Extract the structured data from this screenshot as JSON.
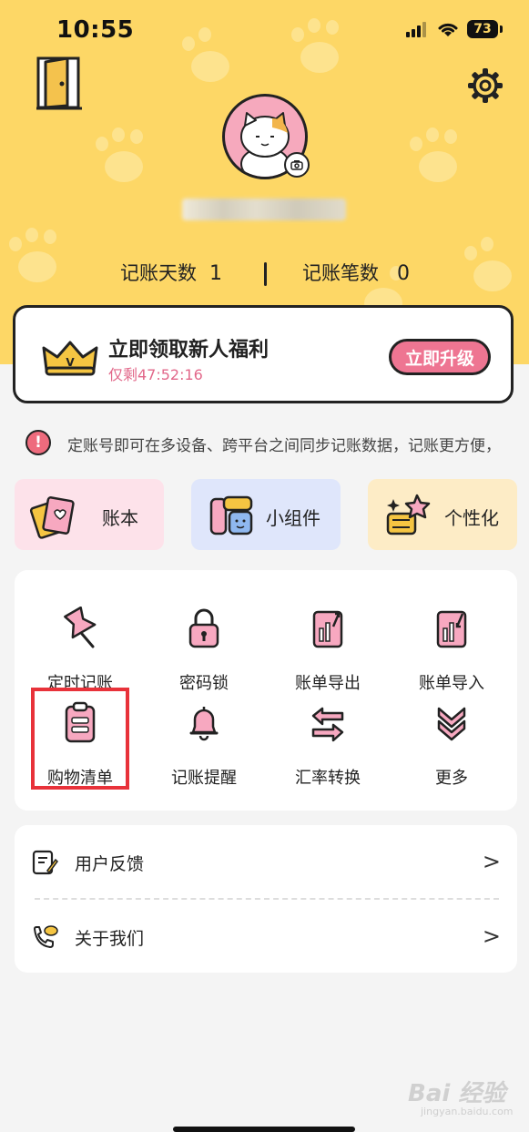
{
  "status_bar": {
    "time": "10:55",
    "battery": "73"
  },
  "profile": {
    "avatar_icon": "cat-avatar-icon"
  },
  "stats": {
    "days_label": "记账天数",
    "days_value": "1",
    "records_label": "记账笔数",
    "records_value": "0"
  },
  "promo": {
    "title": "立即领取新人福利",
    "timer": "仅剩47:52:16",
    "button": "立即升级"
  },
  "notice": {
    "text": "定账号即可在多设备、跨平台之间同步记账数据，记账更方便，"
  },
  "quick_actions": [
    {
      "label": "账本",
      "icon": "ledger-icon",
      "bg": "#fde2ea"
    },
    {
      "label": "小组件",
      "icon": "widget-icon",
      "bg": "#dfe6fb"
    },
    {
      "label": "个性化",
      "icon": "personalize-icon",
      "bg": "#fdecc6"
    }
  ],
  "tools": [
    {
      "label": "定时记账",
      "icon": "pushpin-icon"
    },
    {
      "label": "密码锁",
      "icon": "lock-icon"
    },
    {
      "label": "账单导出",
      "icon": "export-icon"
    },
    {
      "label": "账单导入",
      "icon": "import-icon"
    },
    {
      "label": "购物清单",
      "icon": "clipboard-icon"
    },
    {
      "label": "记账提醒",
      "icon": "bell-icon"
    },
    {
      "label": "汇率转换",
      "icon": "exchange-icon"
    },
    {
      "label": "更多",
      "icon": "chevrons-down-icon"
    }
  ],
  "list": [
    {
      "label": "用户反馈",
      "icon": "feedback-icon"
    },
    {
      "label": "关于我们",
      "icon": "phone-chat-icon"
    }
  ],
  "watermark": {
    "main": "Bai 经验",
    "sub": "jingyan.baidu.com"
  },
  "colors": {
    "header_bg": "#fdd766",
    "accent_pink": "#ee7592",
    "highlight_red": "#e8323a"
  }
}
